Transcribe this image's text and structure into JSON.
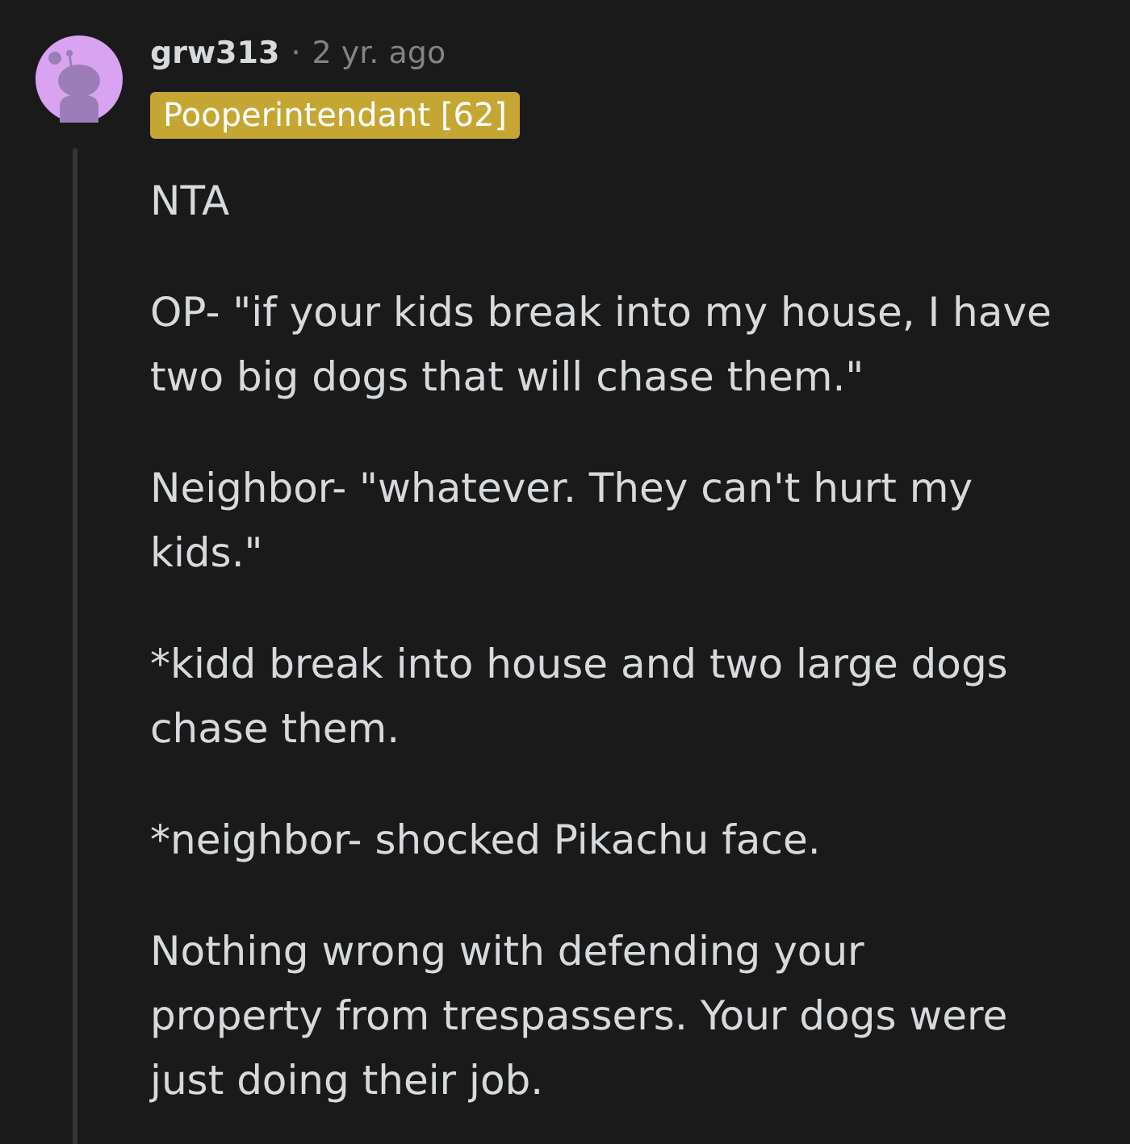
{
  "comment": {
    "author": "grw313",
    "separator": "·",
    "time": "2 yr. ago",
    "flair": "Pooperintendant [62]",
    "paragraphs": [
      "NTA",
      "OP- \"if your kids break into my house, I have\ntwo big dogs that will chase them.\"",
      "Neighbor- \"whatever. They can't hurt my\nkids.\"",
      "*kidd break into house and two large dogs\nchase them.",
      "*neighbor- shocked Pikachu face.",
      "Nothing wrong with defending your\nproperty from trespassers. Your dogs were\njust doing their job."
    ]
  }
}
